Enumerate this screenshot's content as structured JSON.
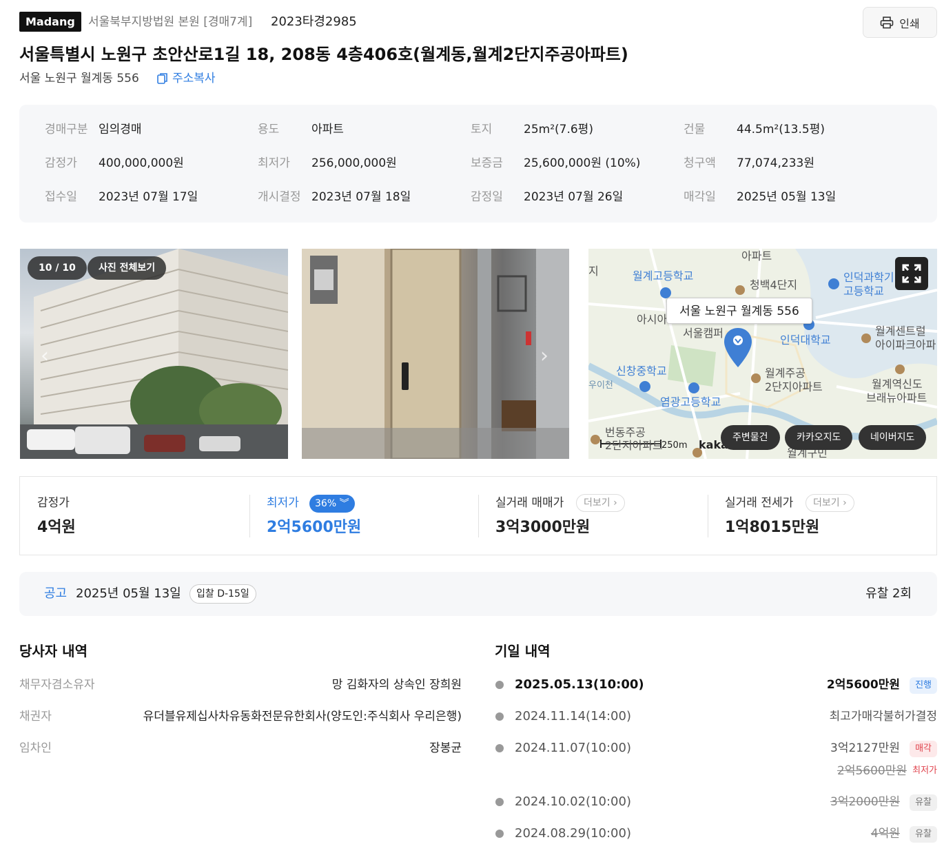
{
  "header": {
    "logo": "Madang",
    "court": "서울북부지방법원 본원 [경매7계]",
    "case_no": "2023타경2985",
    "print_label": "인쇄",
    "title": "서울특별시 노원구 초안산로1길 18, 208동 4층406호(월계동,월계2단지주공아파트)",
    "sub_address": "서울 노원구 월계동 556",
    "copy_label": "주소복사"
  },
  "info": [
    {
      "label": "경매구분",
      "value": "임의경매"
    },
    {
      "label": "용도",
      "value": "아파트"
    },
    {
      "label": "토지",
      "value": "25m²(7.6평)"
    },
    {
      "label": "건물",
      "value": "44.5m²(13.5평)"
    },
    {
      "label": "감정가",
      "value": "400,000,000원"
    },
    {
      "label": "최저가",
      "value": "256,000,000원"
    },
    {
      "label": "보증금",
      "value": "25,600,000원 (10%)"
    },
    {
      "label": "청구액",
      "value": "77,074,233원"
    },
    {
      "label": "접수일",
      "value": "2023년 07월 17일"
    },
    {
      "label": "개시결정",
      "value": "2023년 07월 18일"
    },
    {
      "label": "감정일",
      "value": "2023년 07월 26일"
    },
    {
      "label": "매각일",
      "value": "2025년 05월 13일"
    }
  ],
  "photos": {
    "counter": "10 / 10",
    "view_all": "사진 전체보기"
  },
  "map": {
    "tooltip": "서울 노원구 월계동 556",
    "labels": [
      {
        "text": "아파트",
        "cls": "l1"
      },
      {
        "text": "월계고등학교",
        "cls": "l2"
      },
      {
        "text": "청백4단지",
        "cls": "l3"
      },
      {
        "text": "인덕과학기",
        "cls": "l4"
      },
      {
        "text": "고등학교",
        "cls": "l5"
      },
      {
        "text": "아시아",
        "cls": "l6"
      },
      {
        "text": "서울캠퍼",
        "cls": "l7"
      },
      {
        "text": "인덕대학교",
        "cls": "l8"
      },
      {
        "text": "월계센트럴",
        "cls": "l9"
      },
      {
        "text": "아이파크아파",
        "cls": "l10"
      },
      {
        "text": "신창중학교",
        "cls": "l11"
      },
      {
        "text": "월계주공",
        "cls": "l12"
      },
      {
        "text": "2단지아파트",
        "cls": "l13"
      },
      {
        "text": "월계역신도",
        "cls": "l14"
      },
      {
        "text": "브래뉴아파트",
        "cls": "l15"
      },
      {
        "text": "염광고등학교",
        "cls": "l16"
      },
      {
        "text": "번동주공",
        "cls": "l17"
      },
      {
        "text": "2단지아파트",
        "cls": "l18"
      },
      {
        "text": "월계구민",
        "cls": "l19"
      },
      {
        "text": "지",
        "cls": "l20"
      },
      {
        "text": "우이천",
        "cls": "l21"
      }
    ],
    "scale": "250m",
    "brand": "kakao",
    "btn_nearby": "주변물건",
    "btn_kakao": "카카오지도",
    "btn_naver": "네이버지도"
  },
  "prices": {
    "appraisal_label": "감정가",
    "appraisal_value": "4억원",
    "min_label": "최저가",
    "min_pct": "36%",
    "min_value": "2억5600만원",
    "trade_label": "실거래 매매가",
    "trade_value": "3억3000만원",
    "rent_label": "실거래 전세가",
    "rent_value": "1억8015만원",
    "more_label": "더보기"
  },
  "notice": {
    "label": "공고",
    "date": "2025년 05월 13일",
    "dday": "입찰 D-15일",
    "fail_count": "유찰 2회"
  },
  "parties": {
    "title": "당사자 내역",
    "rows": [
      {
        "label": "채무자겸소유자",
        "value": "망 김화자의 상속인 장희원"
      },
      {
        "label": "채권자",
        "value": "유더블유제십사차유동화전문유한회사(양도인:주식회사 우리은행)"
      },
      {
        "label": "임차인",
        "value": "장봉균"
      }
    ]
  },
  "schedule": {
    "title": "기일 내역",
    "rows": [
      {
        "date": "2025.05.13(10:00)",
        "amount": "2억5600만원",
        "tag": "진행"
      },
      {
        "date": "2024.11.14(14:00)",
        "amount": "최고가매각불허가결정",
        "tag": ""
      },
      {
        "date": "2024.11.07(10:00)",
        "amount": "3억2127만원",
        "tag": "매각",
        "sub_amount": "2억5600만원",
        "sub_tag": "최저가"
      },
      {
        "date": "2024.10.02(10:00)",
        "amount": "3억2000만원",
        "tag": "유찰"
      },
      {
        "date": "2024.08.29(10:00)",
        "amount": "4억원",
        "tag": "유찰"
      }
    ]
  },
  "colors": {
    "accent": "#2f7de1",
    "sold": "#e0434d"
  }
}
